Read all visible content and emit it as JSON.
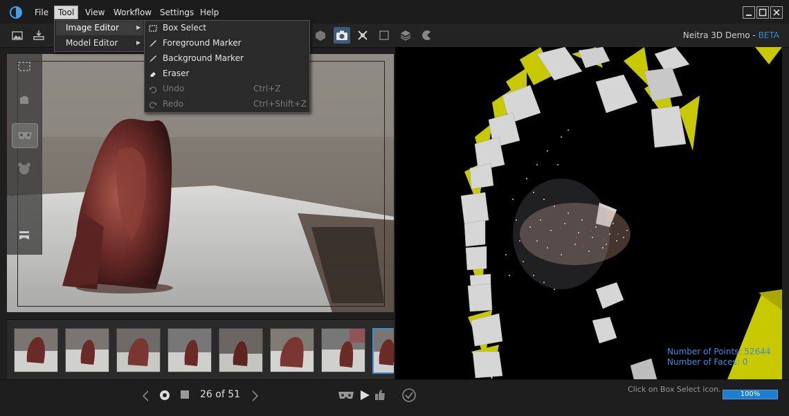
{
  "menubar": {
    "items": [
      "File",
      "Tool",
      "View",
      "Workflow",
      "Settings",
      "Help"
    ]
  },
  "brand": {
    "name": "Neitra 3D Demo - ",
    "badge": "BETA"
  },
  "tool_menu": {
    "items": [
      "Image Editor",
      "Model Editor"
    ]
  },
  "image_editor_menu": {
    "items": [
      {
        "label": "Box Select",
        "shortcut": "",
        "icon": "box-select-icon"
      },
      {
        "label": "Foreground Marker",
        "shortcut": "",
        "icon": "brush-icon"
      },
      {
        "label": "Background Marker",
        "shortcut": "",
        "icon": "brush-icon"
      },
      {
        "label": "Eraser",
        "shortcut": "",
        "icon": "eraser-icon"
      },
      {
        "label": "Undo",
        "shortcut": "Ctrl+Z",
        "icon": "undo-icon"
      },
      {
        "label": "Redo",
        "shortcut": "Ctrl+Shift+Z",
        "icon": "redo-icon"
      }
    ]
  },
  "navigation": {
    "counter": "26 of 51"
  },
  "viewport": {
    "points_label": "Number of Points: 52644",
    "faces_label": "Number of Faces: 0"
  },
  "status": {
    "hint": "Click on Box Select icon.",
    "progress_label": "100%",
    "progress_fraction": 1.0
  },
  "colors": {
    "accent": "#2e8fd4",
    "camera_yellow": "#c8c800"
  }
}
